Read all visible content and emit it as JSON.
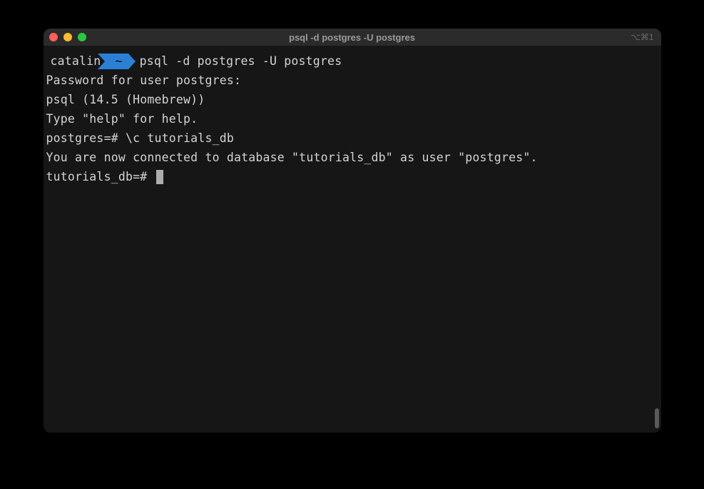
{
  "window": {
    "title": "psql -d postgres -U postgres",
    "shortcut": "⌥⌘1"
  },
  "prompt": {
    "user": "catalin",
    "badge": "~",
    "command": "psql -d postgres -U postgres"
  },
  "lines": {
    "l1": "Password for user postgres:",
    "l2": "psql (14.5 (Homebrew))",
    "l3": "Type \"help\" for help.",
    "l4": "",
    "l5": "postgres=# \\c tutorials_db",
    "l6": "You are now connected to database \"tutorials_db\" as user \"postgres\".",
    "l7": "tutorials_db=# "
  },
  "colors": {
    "bg": "#161616",
    "titlebar": "#2b2b2b",
    "text": "#d4d4d4",
    "badge": "#2b80d6"
  }
}
